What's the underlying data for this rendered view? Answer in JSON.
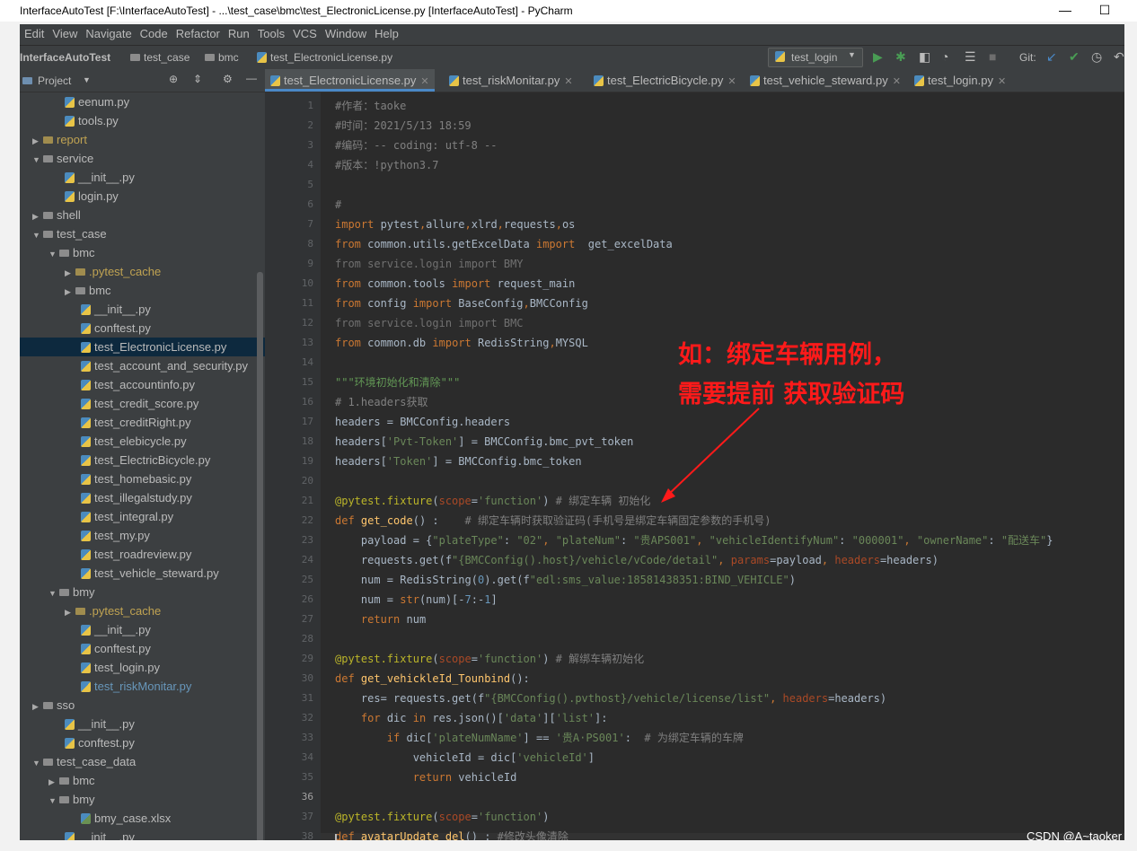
{
  "window": {
    "title": "InterfaceAutoTest [F:\\InterfaceAutoTest] - ...\\test_case\\bmc\\test_ElectronicLicense.py [InterfaceAutoTest] - PyCharm"
  },
  "menu": [
    "Edit",
    "View",
    "Navigate",
    "Code",
    "Refactor",
    "Run",
    "Tools",
    "VCS",
    "Window",
    "Help"
  ],
  "breadcrumb": {
    "project": "InterfaceAutoTest",
    "c1": "test_case",
    "c2": "bmc",
    "file": "test_ElectronicLicense.py"
  },
  "toolbar": {
    "run_config": "test_login",
    "git_label": "Git:"
  },
  "project_panel": {
    "title": "Project"
  },
  "tree": [
    {
      "label": "eenum.py"
    },
    {
      "label": "tools.py"
    },
    {
      "label": "report"
    },
    {
      "label": "service"
    },
    {
      "label": "__init__.py"
    },
    {
      "label": "login.py"
    },
    {
      "label": "shell"
    },
    {
      "label": "test_case"
    },
    {
      "label": "bmc"
    },
    {
      "label": ".pytest_cache"
    },
    {
      "label": "bmc"
    },
    {
      "label": "__init__.py"
    },
    {
      "label": "conftest.py"
    },
    {
      "label": "test_ElectronicLicense.py"
    },
    {
      "label": "test_account_and_security.py"
    },
    {
      "label": "test_accountinfo.py"
    },
    {
      "label": "test_credit_score.py"
    },
    {
      "label": "test_creditRight.py"
    },
    {
      "label": "test_elebicycle.py"
    },
    {
      "label": "test_ElectricBicycle.py"
    },
    {
      "label": "test_homebasic.py"
    },
    {
      "label": "test_illegalstudy.py"
    },
    {
      "label": "test_integral.py"
    },
    {
      "label": "test_my.py"
    },
    {
      "label": "test_roadreview.py"
    },
    {
      "label": "test_vehicle_steward.py"
    },
    {
      "label": "bmy"
    },
    {
      "label": ".pytest_cache"
    },
    {
      "label": "__init__.py"
    },
    {
      "label": "conftest.py"
    },
    {
      "label": "test_login.py"
    },
    {
      "label": "test_riskMonitar.py"
    },
    {
      "label": "sso"
    },
    {
      "label": "__init__.py"
    },
    {
      "label": "conftest.py"
    },
    {
      "label": "test_case_data"
    },
    {
      "label": "bmc"
    },
    {
      "label": "bmy"
    },
    {
      "label": "bmy_case.xlsx"
    },
    {
      "label": "__init__.py"
    }
  ],
  "tabs": [
    {
      "label": "test_ElectronicLicense.py"
    },
    {
      "label": "test_riskMonitar.py"
    },
    {
      "label": "test_ElectricBicycle.py"
    },
    {
      "label": "test_vehicle_steward.py"
    },
    {
      "label": "test_login.py"
    }
  ],
  "code_lines": [
    "#作者：taoke",
    "#时间：2021/5/13 18:59",
    "#编码：-- coding: utf-8 --",
    "#版本：!python3.7",
    "",
    "#",
    "import pytest,allure,xlrd,requests,os",
    "from common.utils.getExcelData import  get_excelData",
    "from service.login import BMY",
    "from common.tools import request_main",
    "from config import BaseConfig,BMCConfig",
    "from service.login import BMC",
    "from common.db import RedisString,MYSQL",
    "",
    "\"\"\"环境初始化和清除\"\"\"",
    "# 1.headers获取",
    "headers = BMCConfig.headers",
    "headers['Pvt-Token'] = BMCConfig.bmc_pvt_token",
    "headers['Token'] = BMCConfig.bmc_token",
    "",
    "@pytest.fixture(scope='function') # 绑定车辆 初始化",
    "def get_code() :    # 绑定车辆时获取验证码(手机号是绑定车辆固定参数的手机号)",
    "    payload = {\"plateType\": \"02\", \"plateNum\": \"贵APS001\", \"vehicleIdentifyNum\": \"000001\", \"ownerName\": \"配送车\"}",
    "    requests.get(f\"{BMCConfig().host}/vehicle/vCode/detail\", params=payload, headers=headers)",
    "    num = RedisString(0).get(f\"edl:sms_value:18581438351:BIND_VEHICLE\")",
    "    num = str(num)[-7:-1]",
    "    return num",
    "",
    "@pytest.fixture(scope='function') # 解绑车辆初始化",
    "def get_vehickleId_Tounbind():",
    "    res= requests.get(f\"{BMCConfig().pvthost}/vehicle/license/list\", headers=headers)",
    "    for dic in res.json()['data']['list']:",
    "        if dic['plateNumName'] == '贵A·PS001':  # 为绑定车辆的车牌",
    "            vehicleId = dic['vehicleId']",
    "            return vehicleId",
    "",
    "@pytest.fixture(scope='function')",
    "def avatarUpdate_del() : #修改头像清除"
  ],
  "annotation": {
    "line1": "如：绑定车辆用例，",
    "line2": "需要提前 获取验证码"
  },
  "watermark": "CSDN @A~taoker"
}
